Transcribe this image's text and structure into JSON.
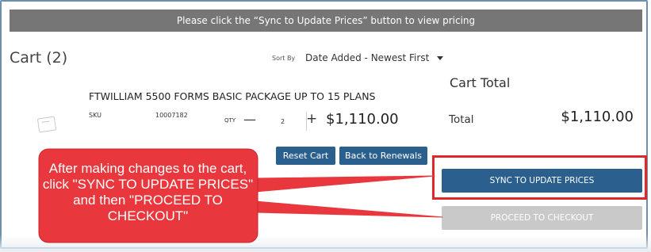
{
  "banner": {
    "text": "Please click the “Sync to Update Prices” button to view pricing"
  },
  "cart": {
    "title": "Cart (2)",
    "sort_by_label": "Sort By",
    "sort_by_value": "Date Added - Newest First"
  },
  "item": {
    "name": "FTWILLIAM 5500 FORMS BASIC PACKAGE UP TO 15 PLANS",
    "sku_label": "SKU",
    "sku": "10007182",
    "qty_label": "QTY",
    "qty": "2",
    "minus": "—",
    "plus": "+",
    "price": "$1,110.00"
  },
  "summary": {
    "heading": "Cart Total",
    "total_label": "Total",
    "total_value": "$1,110.00"
  },
  "buttons": {
    "reset": "Reset Cart",
    "renewals": "Back to Renewals",
    "sync": "SYNC TO UPDATE PRICES",
    "checkout": "PROCEED TO CHECKOUT"
  },
  "callout": {
    "text": "After making changes to the cart, click \"SYNC TO UPDATE PRICES\" and then \"PROCEED TO CHECKOUT\""
  },
  "colors": {
    "banner_bg": "#767676",
    "primary_button": "#2b5f8e",
    "disabled_button": "#c9c9c9",
    "callout_red": "#e8373d",
    "highlight_red": "#e0272c"
  },
  "icons": {
    "sort_caret": "caret-down-icon",
    "item_image": "image-placeholder-icon"
  }
}
